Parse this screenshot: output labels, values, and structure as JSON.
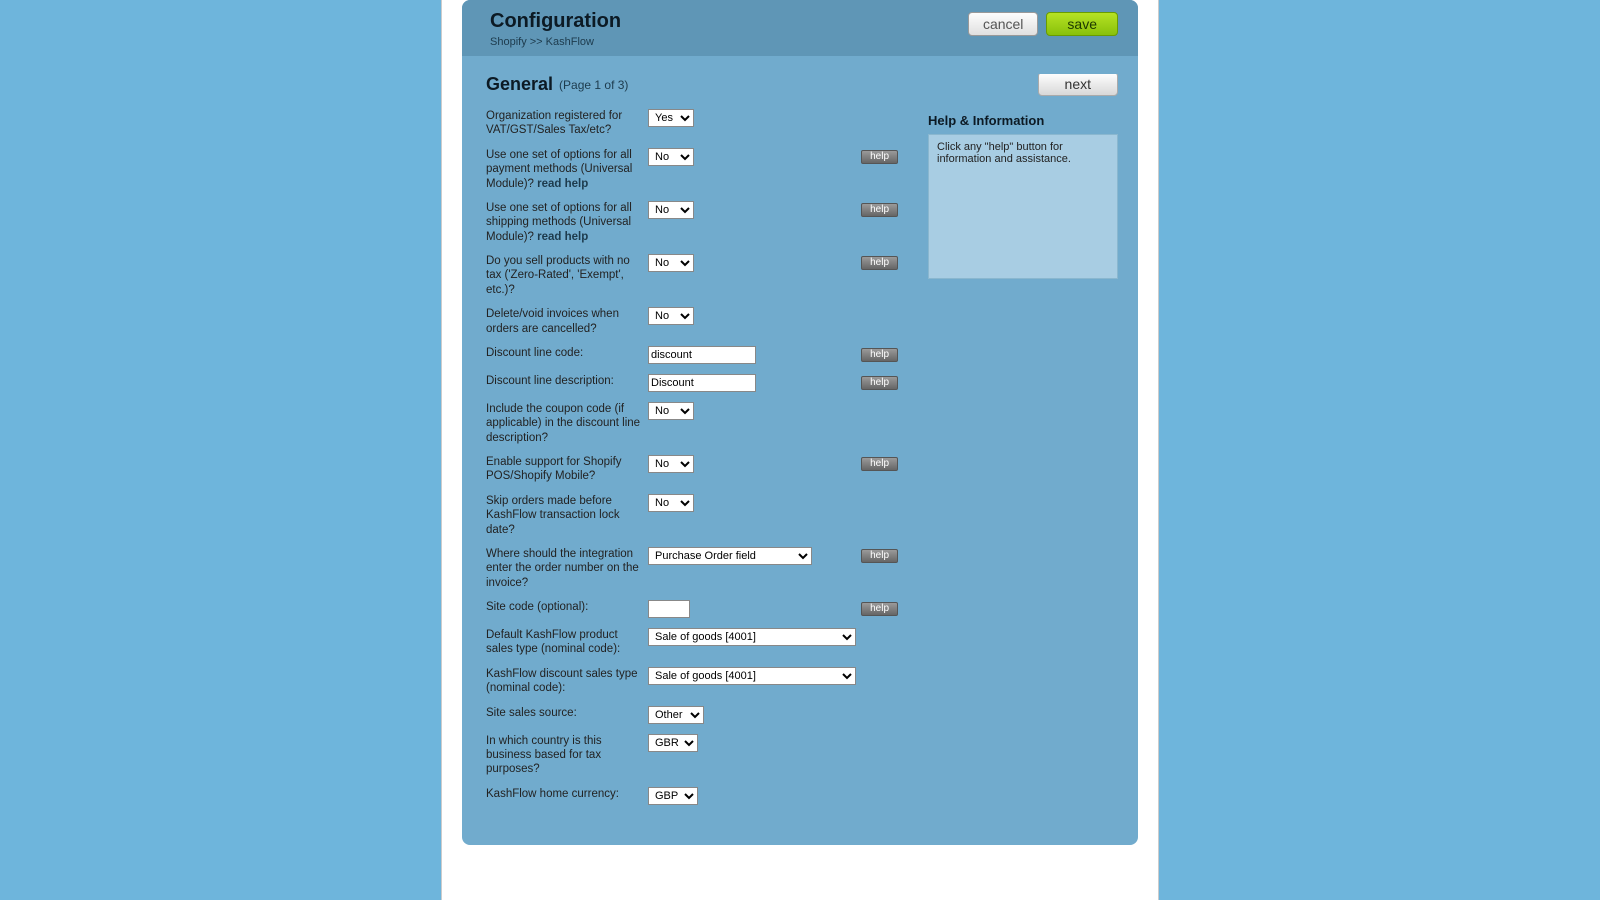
{
  "header": {
    "title": "Configuration",
    "breadcrumb": "Shopify >> KashFlow",
    "cancel": "cancel",
    "save": "save"
  },
  "section": {
    "title": "General",
    "page": "(Page 1 of 3)",
    "next": "next"
  },
  "help_panel": {
    "title": "Help & Information",
    "body": "Click any \"help\" button for information and assistance."
  },
  "help_label": "help",
  "read_help": "read help",
  "rows": {
    "r0": {
      "label": "Organization registered for VAT/GST/Sales Tax/etc?",
      "value": "Yes"
    },
    "r1": {
      "label": "Use one set of options for all payment methods (Universal Module)? ",
      "value": "No"
    },
    "r2": {
      "label": "Use one set of options for all shipping methods (Universal Module)? ",
      "value": "No"
    },
    "r3": {
      "label": "Do you sell products with no tax ('Zero-Rated', 'Exempt', etc.)?",
      "value": "No"
    },
    "r4": {
      "label": "Delete/void invoices when orders are cancelled?",
      "value": "No"
    },
    "r5": {
      "label": "Discount line code:",
      "value": "discount"
    },
    "r6": {
      "label": "Discount line description:",
      "value": "Discount"
    },
    "r7": {
      "label": "Include the coupon code (if applicable) in the discount line description?",
      "value": "No"
    },
    "r8": {
      "label": "Enable support for Shopify POS/Shopify Mobile?",
      "value": "No"
    },
    "r9": {
      "label": "Skip orders made before KashFlow transaction lock date?",
      "value": "No"
    },
    "r10": {
      "label": "Where should the integration enter the order number on the invoice?",
      "value": "Purchase Order field"
    },
    "r11": {
      "label": "Site code (optional):",
      "value": ""
    },
    "r12": {
      "label": "Default KashFlow product sales type (nominal code):",
      "value": "Sale of goods [4001]"
    },
    "r13": {
      "label": "KashFlow discount sales type (nominal code):",
      "value": "Sale of goods [4001]"
    },
    "r14": {
      "label": "Site sales source:",
      "value": "Other"
    },
    "r15": {
      "label": "In which country is this business based for tax purposes?",
      "value": "GBR"
    },
    "r16": {
      "label": "KashFlow home currency:",
      "value": "GBP"
    }
  }
}
